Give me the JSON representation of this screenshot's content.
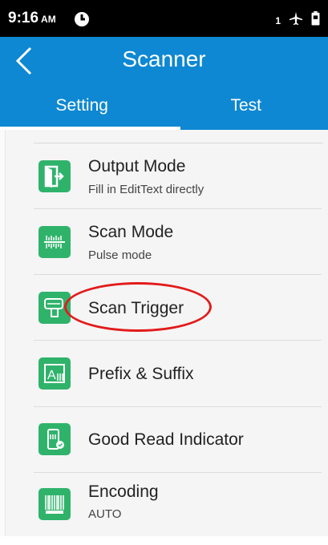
{
  "status": {
    "time": "9:16",
    "ampm": "AM",
    "sim": "1"
  },
  "header": {
    "title": "Scanner"
  },
  "tabs": [
    {
      "label": "Setting",
      "selected": true
    },
    {
      "label": "Test",
      "selected": false
    }
  ],
  "items": [
    {
      "title": "Output Mode",
      "subtitle": "Fill in EditText directly",
      "icon": "output-mode-icon"
    },
    {
      "title": "Scan Mode",
      "subtitle": "Pulse mode",
      "icon": "scan-mode-icon"
    },
    {
      "title": "Scan Trigger",
      "subtitle": "",
      "icon": "scan-trigger-icon"
    },
    {
      "title": "Prefix & Suffix",
      "subtitle": "",
      "icon": "prefix-suffix-icon"
    },
    {
      "title": "Good Read Indicator",
      "subtitle": "",
      "icon": "good-read-indicator-icon"
    },
    {
      "title": "Encoding",
      "subtitle": "AUTO",
      "icon": "encoding-icon"
    }
  ],
  "colors": {
    "accent": "#0e88d2",
    "icon_bg": "#2fb36b",
    "highlight": "#e31b1b"
  }
}
